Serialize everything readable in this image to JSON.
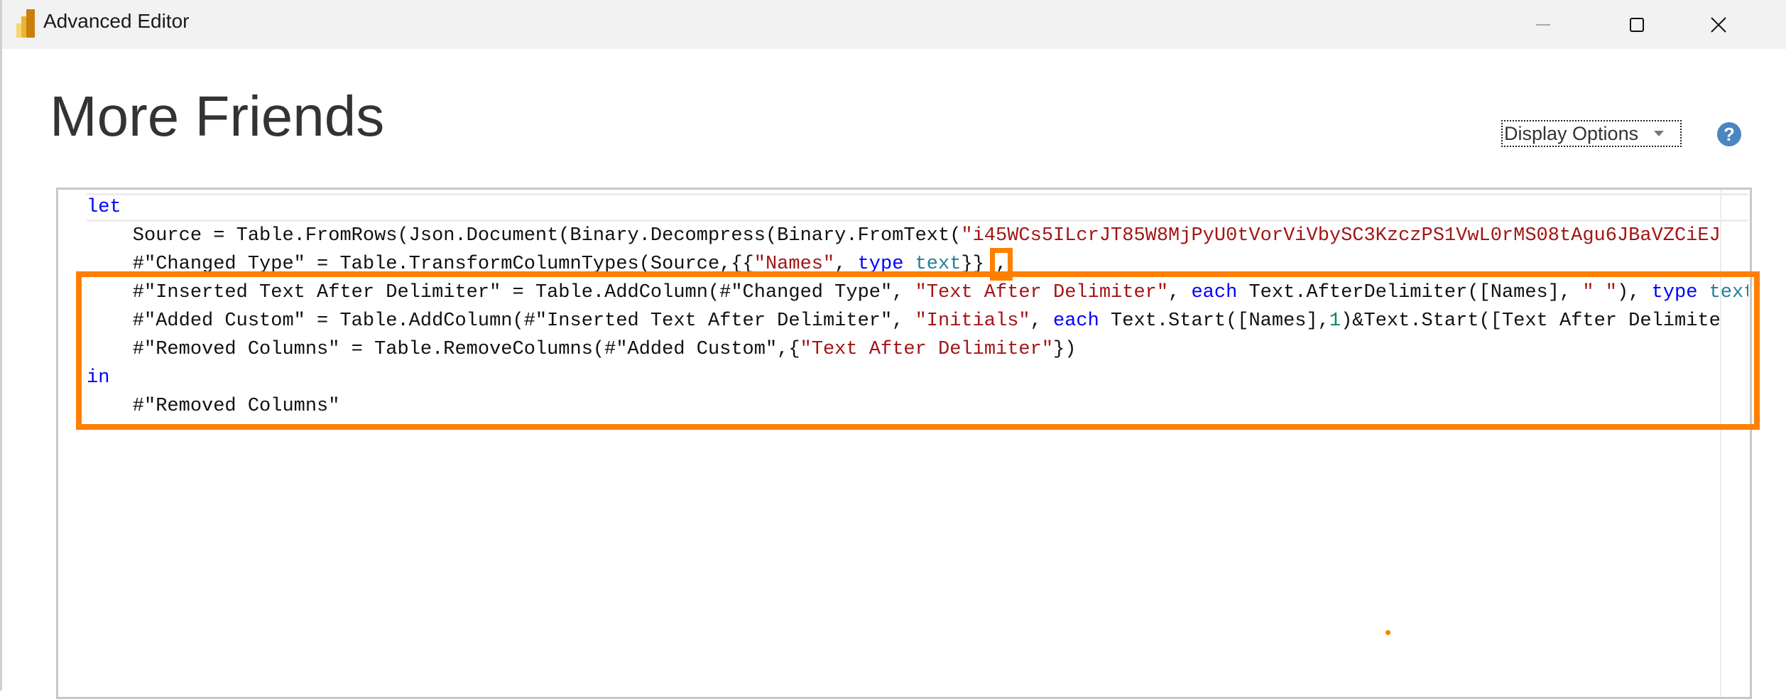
{
  "window": {
    "title": "Advanced Editor",
    "controls": {
      "minimize": "minimize-icon",
      "maximize": "maximize-icon",
      "close": "close-icon"
    }
  },
  "query_name": "More Friends",
  "display_options_label": "Display Options",
  "help_label": "?",
  "colors": {
    "keyword": "#0000ff",
    "string": "#a31515",
    "type": "#267f99",
    "number": "#098658",
    "annotation": "#ff7f00"
  },
  "code_lines": [
    [
      {
        "t": "let",
        "c": "kw"
      }
    ],
    [
      {
        "t": "    Source = Table.FromRows(Json.Document(Binary.Decompress(Binary.FromText(",
        "c": ""
      },
      {
        "t": "\"i45WCs5ILcrJT85W8MjPyU0tVorViVbySC3KzczPS1VwL0rMS08tAgu6JBaVZCiEJ",
        "c": "str"
      }
    ],
    [
      {
        "t": "    #\"Changed Type\" = Table.TransformColumnTypes(Source,{{",
        "c": ""
      },
      {
        "t": "\"Names\"",
        "c": "str"
      },
      {
        "t": ", ",
        "c": ""
      },
      {
        "t": "type",
        "c": "kw"
      },
      {
        "t": " ",
        "c": ""
      },
      {
        "t": "text",
        "c": "typ"
      },
      {
        "t": "}} ",
        "c": ""
      },
      {
        "t": ",",
        "c": "boxed"
      }
    ],
    [
      {
        "t": "    #\"Inserted Text After Delimiter\" = Table.AddColumn(#\"Changed Type\", ",
        "c": ""
      },
      {
        "t": "\"Text After Delimiter\"",
        "c": "str"
      },
      {
        "t": ", ",
        "c": ""
      },
      {
        "t": "each",
        "c": "kw"
      },
      {
        "t": " Text.AfterDelimiter([Names], ",
        "c": ""
      },
      {
        "t": "\" \"",
        "c": "str"
      },
      {
        "t": "), ",
        "c": ""
      },
      {
        "t": "type",
        "c": "kw"
      },
      {
        "t": " ",
        "c": ""
      },
      {
        "t": "text",
        "c": "typ"
      }
    ],
    [
      {
        "t": "    #\"Added Custom\" = Table.AddColumn(#\"Inserted Text After Delimiter\", ",
        "c": ""
      },
      {
        "t": "\"Initials\"",
        "c": "str"
      },
      {
        "t": ", ",
        "c": ""
      },
      {
        "t": "each",
        "c": "kw"
      },
      {
        "t": " Text.Start([Names],",
        "c": ""
      },
      {
        "t": "1",
        "c": "num"
      },
      {
        "t": ")&Text.Start([Text After Delimite",
        "c": ""
      }
    ],
    [
      {
        "t": "    #\"Removed Columns\" = Table.RemoveColumns(#\"Added Custom\",{",
        "c": ""
      },
      {
        "t": "\"Text After Delimiter\"",
        "c": "str"
      },
      {
        "t": "})",
        "c": ""
      }
    ],
    [
      {
        "t": "in",
        "c": "kw"
      }
    ],
    [
      {
        "t": "    #\"Removed Columns\"",
        "c": ""
      }
    ]
  ]
}
